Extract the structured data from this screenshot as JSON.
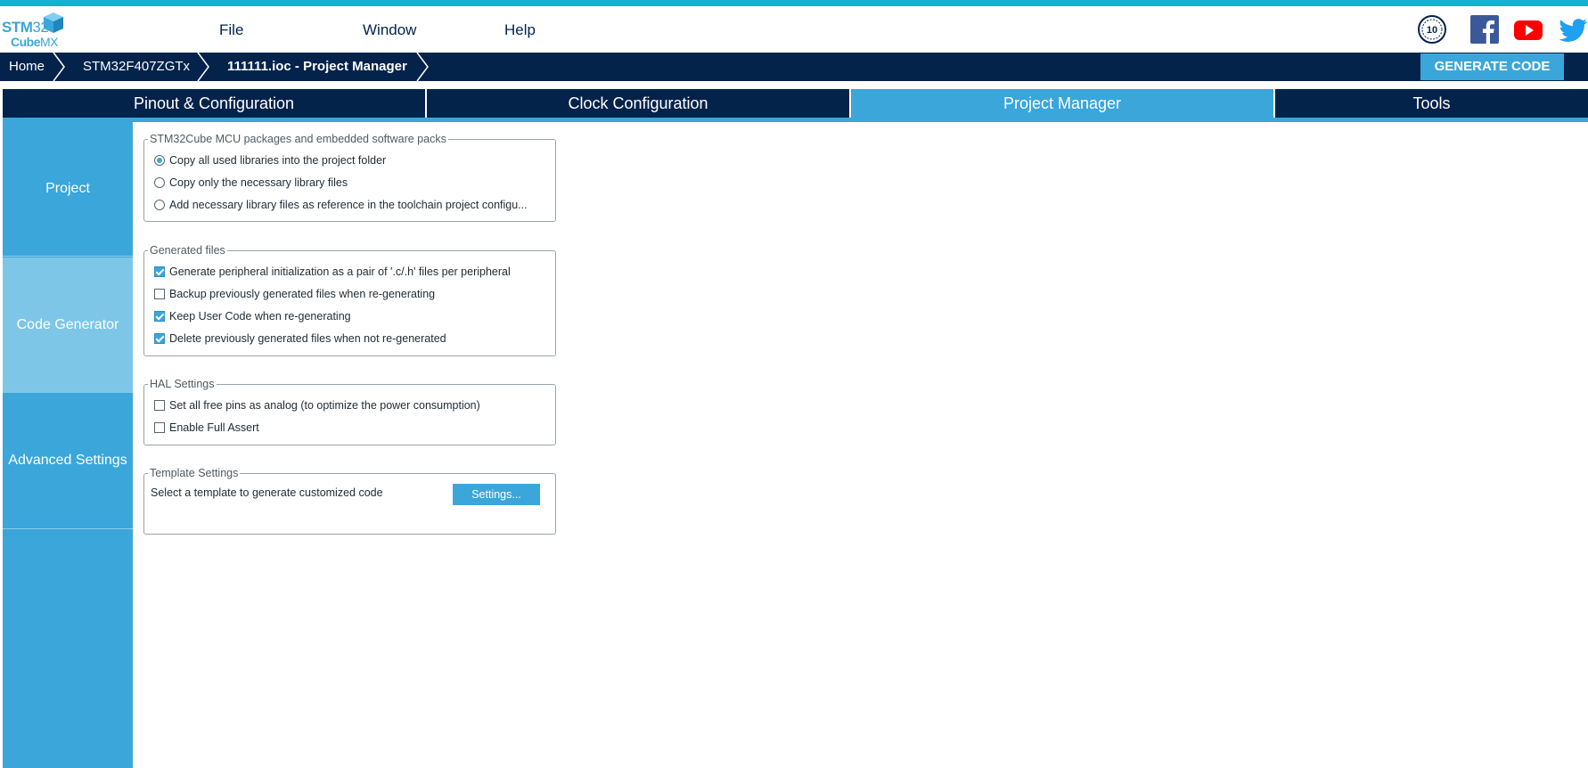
{
  "app": {
    "logo_line1_bold": "STM",
    "logo_line1_light": "32",
    "logo_line2_bold": "Cube",
    "logo_line2_light": "MX",
    "anniversary_badge": "10"
  },
  "menu": {
    "items": [
      {
        "label": "File"
      },
      {
        "label": "Window"
      },
      {
        "label": "Help"
      }
    ]
  },
  "social": {
    "icons": [
      "anniversary-icon",
      "facebook-icon",
      "youtube-icon",
      "twitter-icon"
    ],
    "facebook_color": "#3b5998",
    "youtube_color": "#ff0000",
    "twitter_color": "#1da1f2"
  },
  "breadcrumb": {
    "items": [
      {
        "label": "Home"
      },
      {
        "label": "STM32F407ZGTx"
      },
      {
        "label": "111111.ioc - Project Manager"
      }
    ],
    "generate_label": "GENERATE CODE"
  },
  "tabs": [
    {
      "label": "Pinout & Configuration",
      "active": false
    },
    {
      "label": "Clock Configuration",
      "active": false
    },
    {
      "label": "Project Manager",
      "active": true
    },
    {
      "label": "Tools",
      "active": false
    }
  ],
  "sidenav": {
    "items": [
      {
        "label": "Project",
        "active": false
      },
      {
        "label": "Code Generator",
        "active": true
      },
      {
        "label": "Advanced Settings",
        "active": false
      }
    ]
  },
  "packages": {
    "title": "STM32Cube MCU packages and embedded software packs",
    "options": [
      {
        "label": "Copy all used libraries into the project folder",
        "selected": true
      },
      {
        "label": "Copy only the necessary library files",
        "selected": false
      },
      {
        "label": "Add necessary library files as reference in the toolchain project configu...",
        "selected": false
      }
    ]
  },
  "generated": {
    "title": "Generated files",
    "options": [
      {
        "label": "Generate peripheral initialization as a pair of '.c/.h' files per peripheral",
        "checked": true
      },
      {
        "label": "Backup previously generated files when re-generating",
        "checked": false
      },
      {
        "label": "Keep User Code when re-generating",
        "checked": true
      },
      {
        "label": "Delete previously generated files when not re-generated",
        "checked": true
      }
    ]
  },
  "hal": {
    "title": "HAL Settings",
    "options": [
      {
        "label": "Set all free pins as analog (to optimize the power consumption)",
        "checked": false
      },
      {
        "label": "Enable Full Assert",
        "checked": false
      }
    ]
  },
  "template": {
    "title": "Template Settings",
    "text": "Select a template to generate customized code",
    "button_label": "Settings..."
  },
  "colors": {
    "navy": "#03234b",
    "accent": "#3aa6da",
    "active_side": "#7ec6e8",
    "stripe": "#0fb5c8"
  }
}
